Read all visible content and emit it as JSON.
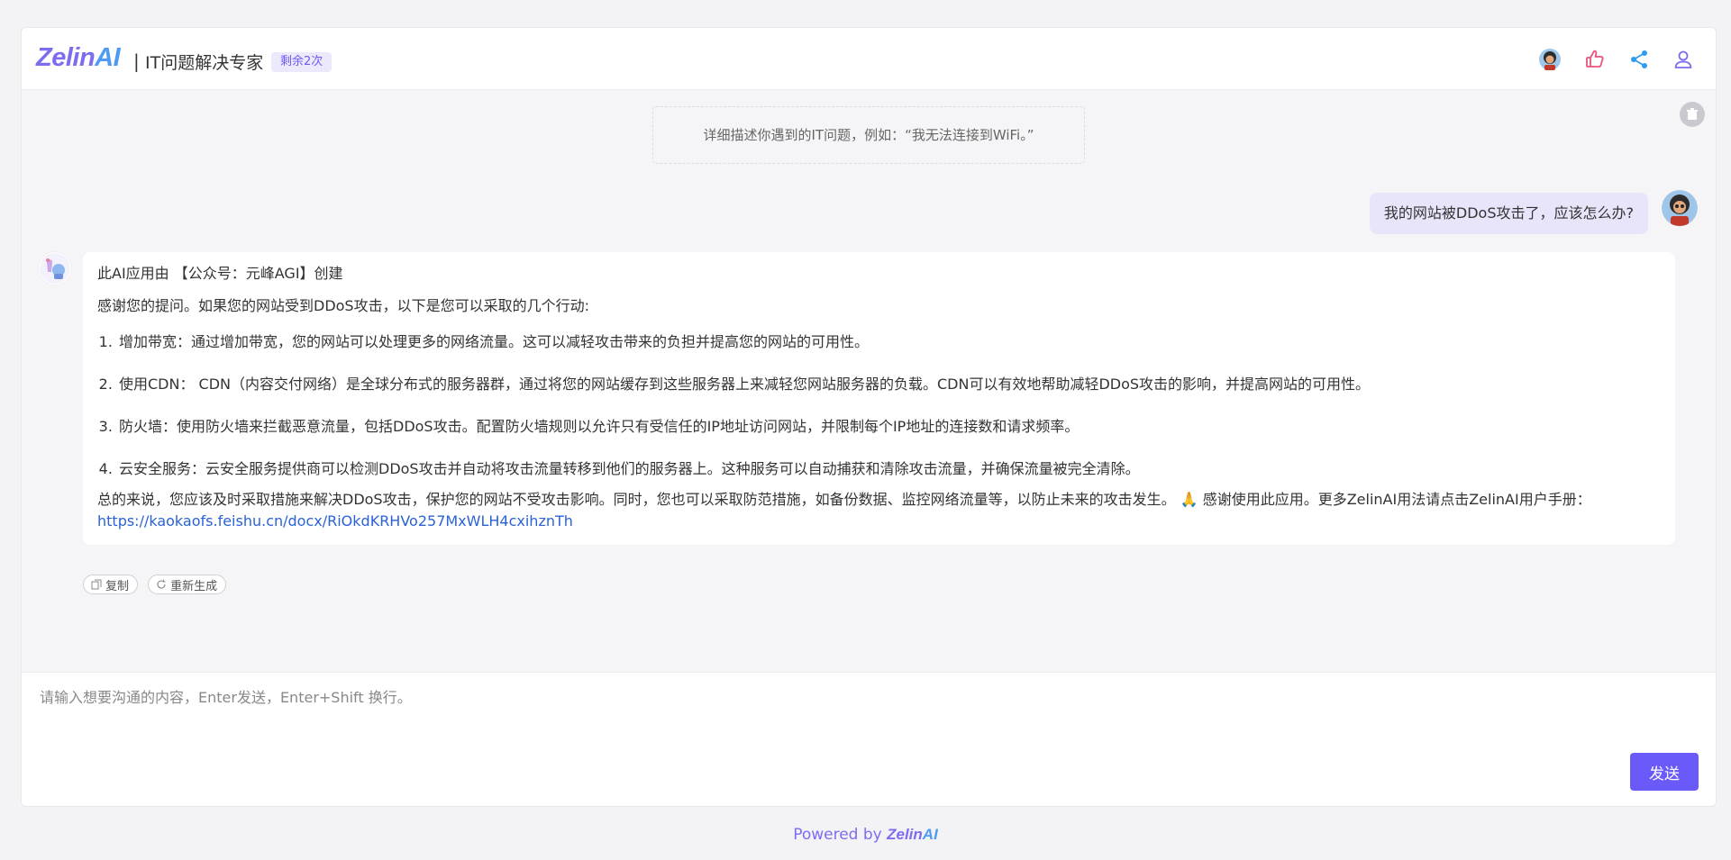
{
  "header": {
    "logo_zelin": "Zelin",
    "logo_ai": "AI",
    "divider": "|",
    "title": "IT问题解决专家",
    "badge": "剩余2次",
    "icons": [
      "user-avatar-icon",
      "thumbs-up-icon",
      "share-icon",
      "account-icon"
    ]
  },
  "chat": {
    "hint": "详细描述你遇到的IT问题，例如：“我无法连接到WiFi。”",
    "user_message": "我的网站被DDoS攻击了，应该怎么办?",
    "bot": {
      "creator": "此AI应用由 【公众号：元峰AGI】创建",
      "intro": "感谢您的提问。如果您的网站受到DDoS攻击，以下是您可以采取的几个行动:",
      "items": [
        "增加带宽：通过增加带宽，您的网站可以处理更多的网络流量。这可以减轻攻击带来的负担并提高您的网站的可用性。",
        "使用CDN： CDN（内容交付网络）是全球分布式的服务器群，通过将您的网站缓存到这些服务器上来减轻您网站服务器的负载。CDN可以有效地帮助减轻DDoS攻击的影响，并提高网站的可用性。",
        "防火墙：使用防火墙来拦截恶意流量，包括DDoS攻击。配置防火墙规则以允许只有受信任的IP地址访问网站，并限制每个IP地址的连接数和请求频率。",
        "云安全服务：云安全服务提供商可以检测DDoS攻击并自动将攻击流量转移到他们的服务器上。这种服务可以自动捕获和清除攻击流量，并确保流量被完全清除。"
      ],
      "summary": "总的来说，您应该及时采取措施来解决DDoS攻击，保护您的网站不受攻击影响。同时，您也可以采取防范措施，如备份数据、监控网络流量等，以防止未来的攻击发生。",
      "emoji": "🙏",
      "thanks": " 感谢使用此应用。更多ZelinAI用法请点击ZelinAI用户手册：",
      "link": "https://kaokaofs.feishu.cn/docx/RiOkdKRHVo257MxWLH4cxihznTh"
    },
    "actions": {
      "copy": "复制",
      "regenerate": "重新生成"
    }
  },
  "input": {
    "placeholder": "请输入想要沟通的内容，Enter发送，Enter+Shift 换行。",
    "value": "",
    "send": "发送"
  },
  "footer": {
    "powered": "Powered by ",
    "brand_zelin": "Zelin",
    "brand_ai": "AI"
  },
  "colors": {
    "accent": "#6a5af9",
    "user_bubble": "#e8e5fb",
    "link": "#2a62d8"
  }
}
